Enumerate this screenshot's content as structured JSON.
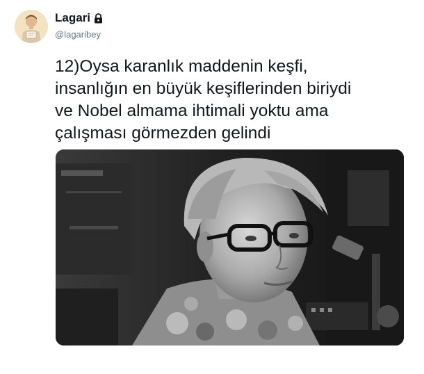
{
  "tweet": {
    "author": {
      "display_name": "Lagari",
      "handle": "@lagaribey",
      "protected_icon": "lock-icon",
      "avatar_icon": "avatar-illustration"
    },
    "text": "12)Oysa karanlık maddenin keşfi,\ninsanlığın en büyük keşiflerinden biriydi\nve Nobel almama ihtimali yoktu ama\nçalışması görmezden gelindi",
    "media": {
      "kind": "photo",
      "description_icon": "black-and-white-portrait-photo"
    }
  },
  "colors": {
    "text_primary": "#14171a",
    "text_secondary": "#657786",
    "background": "#ffffff"
  }
}
